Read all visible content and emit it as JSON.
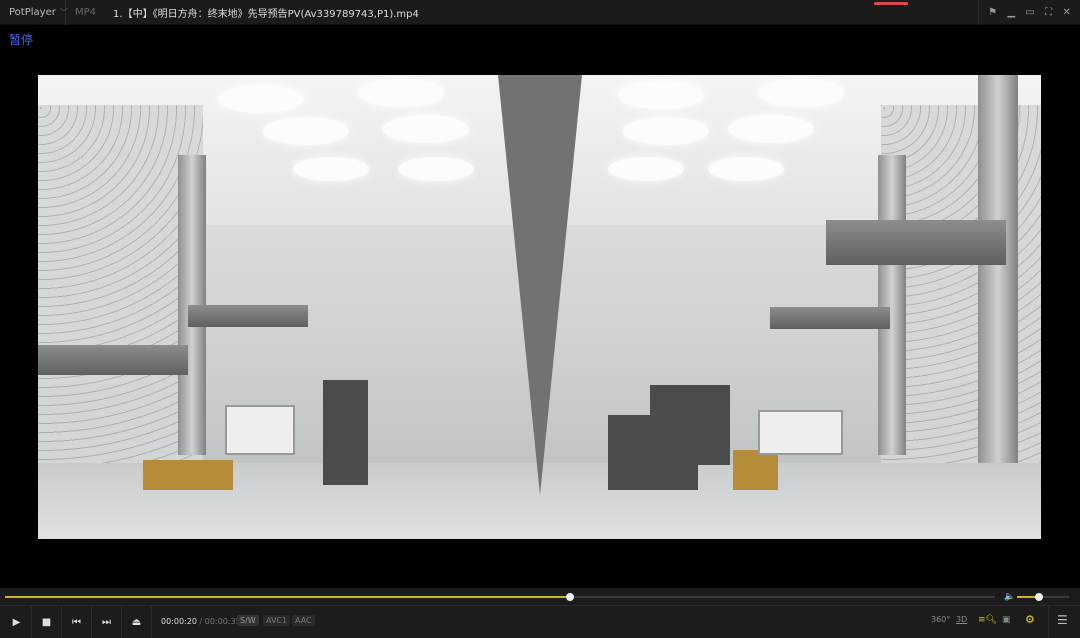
{
  "titlebar": {
    "app": "PotPlayer",
    "format": "MP4",
    "title": "1.【中】《明日方舟：终末地》先导预告PV(Av339789743,P1).mp4"
  },
  "osd": {
    "status": "暂停"
  },
  "playback": {
    "current": "00:00:20",
    "separator": "/",
    "total": "00:00:35",
    "progress": 0.571,
    "volume": 0.42
  },
  "tags": {
    "sw": "S/W",
    "video": "AVC1",
    "audio": "AAC"
  },
  "right_controls": {
    "vr": "360°",
    "three_d": "3D"
  },
  "colors": {
    "accent": "#c8b51f",
    "osd": "#4a64e8"
  }
}
